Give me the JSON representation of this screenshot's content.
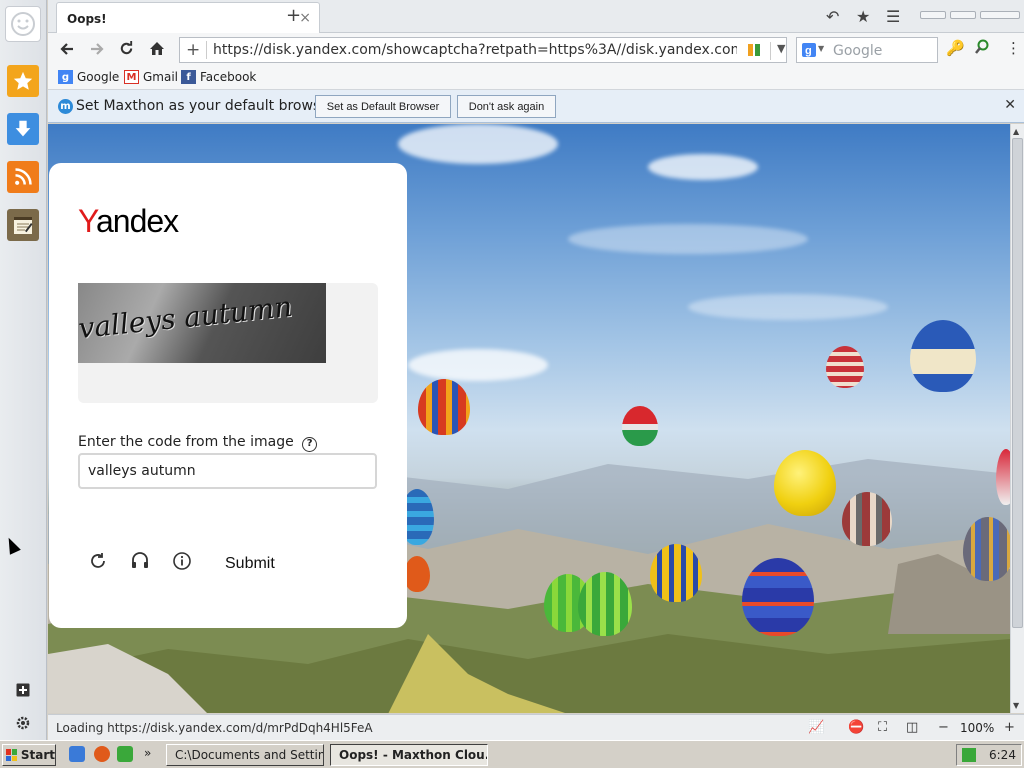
{
  "tab": {
    "title": "Oops!",
    "close": "×",
    "new": "+"
  },
  "navbar": {
    "url": "https://disk.yandex.com/showcaptcha?retpath=https%3A//disk.yandex.com/d/mrPd",
    "search_placeholder": "Google"
  },
  "bookmarks": [
    {
      "label": "Google",
      "icon": "google-icon",
      "color": "#4285f4"
    },
    {
      "label": "Gmail",
      "icon": "gmail-icon",
      "color": "#d93025"
    },
    {
      "label": "Facebook",
      "icon": "facebook-icon",
      "color": "#3b5998"
    }
  ],
  "notification": {
    "text": "Set Maxthon as your default browser?",
    "btn_default": "Set as Default Browser",
    "btn_dismiss": "Don't ask again"
  },
  "card": {
    "logo_y": "Y",
    "logo_rest": "andex",
    "captcha_text": "valleys autumn",
    "label": "Enter the code from the image",
    "help": "?",
    "input_value": "valleys autumn",
    "submit": "Submit"
  },
  "status": {
    "loading": "Loading https://disk.yandex.com/d/mrPdDqh4Hl5FeA",
    "zoom": "100%"
  },
  "taskbar": {
    "start": "Start",
    "task1": "C:\\Documents and Settin...",
    "task2": "Oops! - Maxthon Clou...",
    "clock": "6:24"
  },
  "colors": {
    "accent": "#e01a1a",
    "notif_bg": "#e6eef7"
  }
}
